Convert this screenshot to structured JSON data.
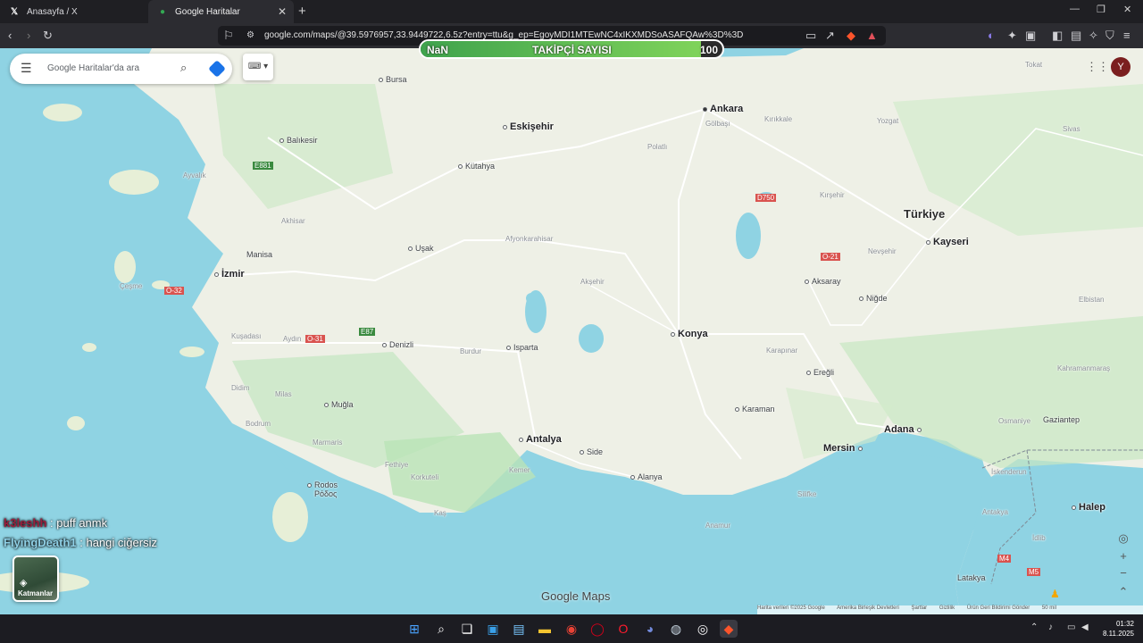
{
  "tabs": [
    {
      "label": "Anasayfa / X",
      "icon": "x-logo-icon"
    },
    {
      "label": "Google Haritalar",
      "icon": "maps-pin-icon"
    }
  ],
  "address_bar": {
    "url": "google.com/maps/@39.5976957,33.9449722,6.5z?entry=ttu&g_ep=EgoyMDI1MTEwNC4xIKXMDSoASAFQAw%3D%3D"
  },
  "overlay": {
    "left_value": "NaN",
    "title": "TAKİPÇİ SAYISI",
    "right_value": "100",
    "progress_fraction": 0.93,
    "colors": {
      "fill": "#6cc24a",
      "bg": "#2d2d2d"
    }
  },
  "search": {
    "placeholder": "Google Haritalar'da ara"
  },
  "user": {
    "avatar_letter": "Y"
  },
  "map_labels": {
    "country": "Türkiye",
    "ankara": "Ankara",
    "eskisehir": "Eskişehir",
    "izmir": "İzmir",
    "konya": "Konya",
    "antalya": "Antalya",
    "adana": "Adana",
    "mersin": "Mersin",
    "kayseri": "Kayseri",
    "bursa": "Bursa",
    "balikesir": "Balıkesir",
    "kutahya": "Kütahya",
    "usak": "Uşak",
    "manisa": "Manisa",
    "denizli": "Denizli",
    "isparta": "Isparta",
    "burdur": "Burdur",
    "afyon": "Afyonkarahisar",
    "aksehir": "Akşehir",
    "aksaray": "Aksaray",
    "nigde": "Niğde",
    "karaman": "Karaman",
    "eregli": "Ereğli",
    "alanya": "Alanya",
    "side": "Side",
    "kemer": "Kemer",
    "kas": "Kaş",
    "fethiye": "Fethiye",
    "marmaris": "Marmaris",
    "bodrum": "Bodrum",
    "milas": "Milas",
    "mugla": "Muğla",
    "didim": "Didim",
    "kusadasi": "Kuşadası",
    "aydin": "Aydın",
    "cesme": "Çeşme",
    "ayvalik": "Ayvalık",
    "akhisar": "Akhisar",
    "polatli": "Polatlı",
    "kirsehir": "Kırşehir",
    "nevsehir": "Nevşehir",
    "yozgat": "Yozgat",
    "sivas": "Sivas",
    "tokat": "Tokat",
    "gaziantep": "Gaziantep",
    "osmaniye": "Osmaniye",
    "iskenderun": "İskenderun",
    "antakya": "Antakya",
    "halep": "Halep",
    "idlib": "İdlib",
    "latakya": "Latakya",
    "rodos": "Rodos",
    "rodos_gr": "Ρόδος",
    "anamur": "Anamur",
    "silifke": "Silifke",
    "kirikkale": "Kırıkkale",
    "golbasi": "Gölbaşı",
    "kahramanmaras": "Kahramanmaraş",
    "elbistan": "Elbistan",
    "karapinar": "Karapınar",
    "korkuteli": "Korkuteli",
    "road_e881": "E881",
    "road_e87": "E87",
    "road_o32": "O-32",
    "road_o31": "O-31",
    "road_o21": "O-21",
    "road_d750": "D750",
    "road_m5": "M5",
    "road_m4": "M4"
  },
  "chat": [
    {
      "user": "k3leshh",
      "message": ": puff anmk"
    },
    {
      "user": "FlyingDeath1",
      "message": ": hangi ciğersiz"
    }
  ],
  "layers_label": "Katmanlar",
  "brand": "Google Maps",
  "footer": {
    "map_data": "Harita verileri ©2025 Google",
    "country": "Amerika Birleşik Devletleri",
    "terms": "Şartlar",
    "privacy": "Gizlilik",
    "feedback": "Ürün Geri Bildirimi Gönder",
    "scale": "50 mil"
  },
  "clock": {
    "time": "01:32",
    "date": "8.11.2025"
  }
}
